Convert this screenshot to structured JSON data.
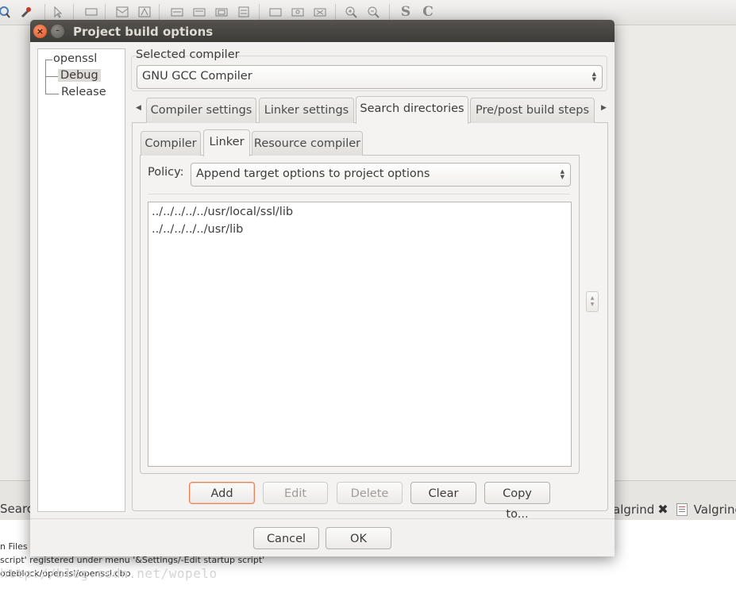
{
  "dialog": {
    "title": "Project build options",
    "close_glyph": "×",
    "minimize_glyph": "–"
  },
  "tree": {
    "root": "openssl",
    "children": [
      "Debug",
      "Release"
    ],
    "selected": "Debug"
  },
  "compiler_group": {
    "label": "Selected compiler",
    "value": "GNU GCC Compiler"
  },
  "main_tabs": {
    "scroll_left": "◀",
    "scroll_right": "▶",
    "items": [
      "Compiler settings",
      "Linker settings",
      "Search directories",
      "Pre/post build steps"
    ],
    "active": "Search directories"
  },
  "sub_tabs": {
    "items": [
      "Compiler",
      "Linker",
      "Resource compiler"
    ],
    "active": "Linker"
  },
  "policy": {
    "label": "Policy:",
    "value": "Append target options to project options"
  },
  "directories": [
    "../../../../../usr/local/ssl/lib",
    "../../../../../usr/lib"
  ],
  "list_buttons": {
    "add": "Add",
    "edit": "Edit",
    "delete": "Delete",
    "clear": "Clear",
    "copy_to": "Copy to..."
  },
  "dialog_buttons": {
    "cancel": "Cancel",
    "ok": "OK"
  },
  "background": {
    "toolbar_letters": [
      "S",
      "C"
    ],
    "bottom_tab_left": "Search",
    "bottom_tab_right_1": "algrind",
    "bottom_tab_right_2": "Valgrind",
    "close_glyph": "✖",
    "log_lines": [
      "n Files p",
      "script' registered under menu '&Settings/-Edit startup script'",
      "odeblock/openssl/openssl.cbp"
    ],
    "watermark": "http://blog.csdn.net/wopelo"
  }
}
